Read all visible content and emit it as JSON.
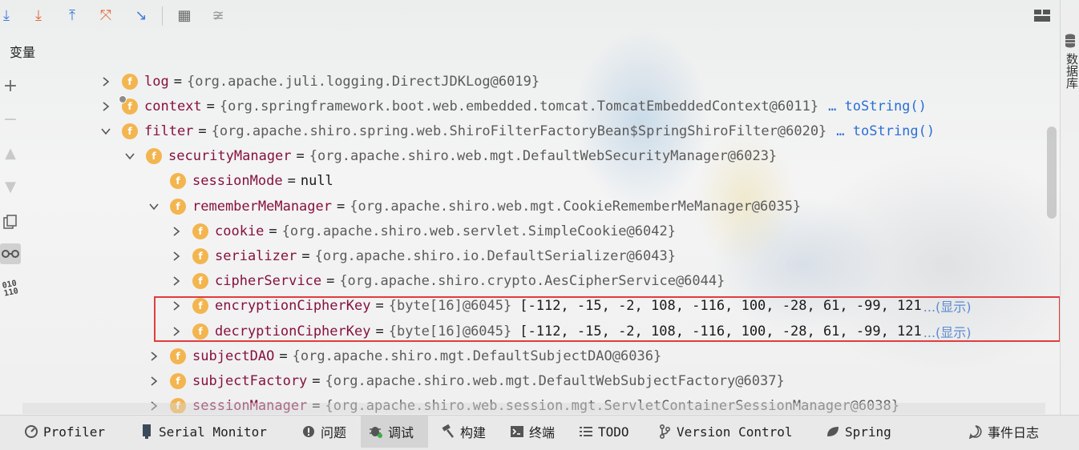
{
  "toolbar": {
    "buttons": [
      {
        "icon": "step-over-icon",
        "glyph": "⤓",
        "color": "#3d7bd8"
      },
      {
        "icon": "force-step-into-icon",
        "glyph": "⤓",
        "color": "#e0683a"
      },
      {
        "icon": "step-out-icon",
        "glyph": "⤒",
        "color": "#3d7bd8"
      },
      {
        "icon": "drop-frame-icon",
        "glyph": "⤧",
        "color": "#e0683a"
      },
      {
        "icon": "run-to-cursor-icon",
        "glyph": "↘",
        "color": "#3d7bd8"
      },
      {
        "icon": "evaluate-expression-icon",
        "glyph": "▦",
        "color": "#666666"
      },
      {
        "icon": "trace-stream-icon",
        "glyph": "≆",
        "color": "#999999"
      }
    ],
    "layout_icon": "layout-icon"
  },
  "panel": {
    "variables_label": "变量"
  },
  "left_gutter": [
    "plus-icon",
    "minus-icon",
    "up-icon",
    "down-icon",
    "copy-icon",
    "watches-glasses-icon",
    "binary-icon"
  ],
  "tree": [
    {
      "chev": ">",
      "name": "log",
      "eq": "=",
      "value": "{org.apache.juli.logging.DirectJDKLog@6019}",
      "locked": false
    },
    {
      "chev": ">",
      "name": "context",
      "eq": "=",
      "value": "{org.springframework.boot.web.embedded.tomcat.TomcatEmbeddedContext@6011}",
      "link": "… toString()",
      "locked": true
    },
    {
      "chev": "v",
      "name": "filter",
      "eq": "=",
      "value": "{org.apache.shiro.spring.web.ShiroFilterFactoryBean$SpringShiroFilter@6020}",
      "link": "… toString()",
      "locked": false
    },
    {
      "chev": "v",
      "name": "securityManager",
      "eq": "=",
      "value": "{org.apache.shiro.web.mgt.DefaultWebSecurityManager@6023}",
      "locked": false
    },
    {
      "chev": "",
      "name": "sessionMode",
      "eq": "=",
      "plain": "null",
      "locked": false
    },
    {
      "chev": "v",
      "name": "rememberMeManager",
      "eq": "=",
      "value": "{org.apache.shiro.web.mgt.CookieRememberMeManager@6035}",
      "locked": false
    },
    {
      "chev": ">",
      "name": "cookie",
      "eq": "=",
      "value": "{org.apache.shiro.web.servlet.SimpleCookie@6042}",
      "locked": false
    },
    {
      "chev": ">",
      "name": "serializer",
      "eq": "=",
      "value": "{org.apache.shiro.io.DefaultSerializer@6043}",
      "locked": false
    },
    {
      "chev": ">",
      "name": "cipherService",
      "eq": "=",
      "value": "{org.apache.shiro.crypto.AesCipherService@6044}",
      "locked": false
    },
    {
      "chev": ">",
      "name": "encryptionCipherKey",
      "eq": "=",
      "value": "{byte[16]@6045}",
      "array": "[-112, -15, -2, 108, -116, 100, -28, 61, -99, 121",
      "show": "...(显示)",
      "locked": false
    },
    {
      "chev": ">",
      "name": "decryptionCipherKey",
      "eq": "=",
      "value": "{byte[16]@6045}",
      "array": "[-112, -15, -2, 108, -116, 100, -28, 61, -99, 121",
      "show": "...(显示)",
      "locked": false
    },
    {
      "chev": ">",
      "name": "subjectDAO",
      "eq": "=",
      "value": "{org.apache.shiro.mgt.DefaultSubjectDAO@6036}",
      "locked": false
    },
    {
      "chev": ">",
      "name": "subjectFactory",
      "eq": "=",
      "value": "{org.apache.shiro.web.mgt.DefaultWebSubjectFactory@6037}",
      "locked": false
    },
    {
      "chev": ">",
      "name": "sessionManager",
      "eq": "=",
      "value": "{org.apache.shiro.web.session.mgt.ServletContainerSessionManager@6038}",
      "locked": false
    }
  ],
  "right_rail": {
    "label": "数据库",
    "icon": "database-icon"
  },
  "statusbar": {
    "items": [
      {
        "label": "Profiler",
        "icon": "profiler-icon",
        "active": false
      },
      {
        "label": "Serial Monitor",
        "icon": "serial-monitor-icon",
        "active": false
      },
      {
        "label": "问题",
        "icon": "problems-icon",
        "active": false
      },
      {
        "label": "调试",
        "icon": "debug-bug-icon",
        "active": true
      },
      {
        "label": "构建",
        "icon": "build-hammer-icon",
        "active": false
      },
      {
        "label": "终端",
        "icon": "terminal-icon",
        "active": false
      },
      {
        "label": "TODO",
        "icon": "todo-list-icon",
        "active": false
      },
      {
        "label": "Version Control",
        "icon": "version-control-icon",
        "active": false
      },
      {
        "label": "Spring",
        "icon": "spring-leaf-icon",
        "active": false
      }
    ],
    "event_log": {
      "label": "事件日志",
      "icon": "event-log-icon"
    }
  },
  "colors": {
    "highlight_border": "#e23c3c",
    "field_icon": "#f3b54f",
    "field_name": "#86113e",
    "link": "#2a6fd6"
  }
}
